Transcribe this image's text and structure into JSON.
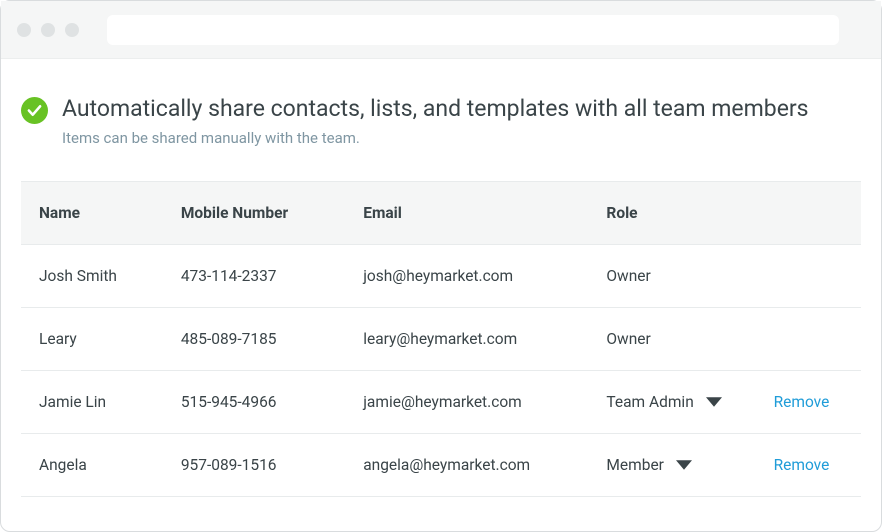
{
  "setting": {
    "title": "Automatically share contacts, lists, and templates with all team members",
    "subtitle": "Items can be shared manually with the team."
  },
  "table": {
    "headers": {
      "name": "Name",
      "mobile": "Mobile Number",
      "email": "Email",
      "role": "Role"
    },
    "rows": [
      {
        "name": "Josh Smith",
        "mobile": "473-114-2337",
        "email": "josh@heymarket.com",
        "role": "Owner",
        "role_editable": false,
        "removable": false
      },
      {
        "name": "Leary",
        "mobile": "485-089-7185",
        "email": "leary@heymarket.com",
        "role": "Owner",
        "role_editable": false,
        "removable": false
      },
      {
        "name": "Jamie Lin",
        "mobile": "515-945-4966",
        "email": "jamie@heymarket.com",
        "role": "Team Admin",
        "role_editable": true,
        "removable": true
      },
      {
        "name": "Angela",
        "mobile": "957-089-1516",
        "email": "angela@heymarket.com",
        "role": "Member",
        "role_editable": true,
        "removable": true
      }
    ]
  },
  "actions": {
    "remove_label": "Remove"
  }
}
